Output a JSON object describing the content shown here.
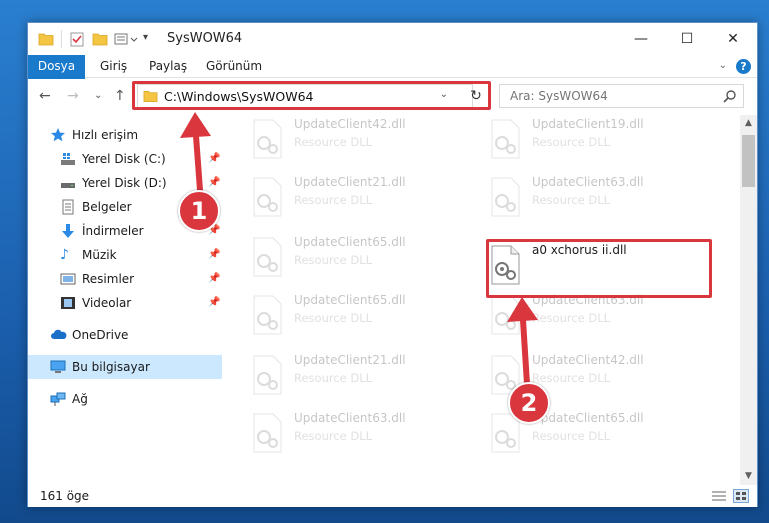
{
  "window": {
    "title": "SysWOW64",
    "controls": {
      "minimize": "—",
      "maximize": "☐",
      "close": "✕"
    }
  },
  "ribbon": {
    "tabs": [
      {
        "label": "Dosya"
      },
      {
        "label": "Giriş"
      },
      {
        "label": "Paylaş"
      },
      {
        "label": "Görünüm"
      }
    ],
    "help": "?"
  },
  "nav": {
    "address": "C:\\Windows\\SysWOW64",
    "search_placeholder": "Ara: SysWOW64"
  },
  "sidebar": {
    "items": [
      {
        "label": "Hızlı erişim"
      },
      {
        "label": "Yerel Disk (C:)"
      },
      {
        "label": "Yerel Disk (D:)"
      },
      {
        "label": "Belgeler"
      },
      {
        "label": "İndirmeler"
      },
      {
        "label": "Müzik"
      },
      {
        "label": "Resimler"
      },
      {
        "label": "Videolar"
      },
      {
        "label": "OneDrive"
      },
      {
        "label": "Bu bilgisayar"
      },
      {
        "label": "Ağ"
      }
    ]
  },
  "files": {
    "left": [
      {
        "name": "UpdateClient42.dll",
        "desc": "Resource DLL"
      },
      {
        "name": "UpdateClient21.dll",
        "desc": "Resource DLL"
      },
      {
        "name": "UpdateClient65.dll",
        "desc": "Resource DLL"
      },
      {
        "name": "UpdateClient65.dll",
        "desc": "Resource DLL"
      },
      {
        "name": "UpdateClient21.dll",
        "desc": "Resource DLL"
      },
      {
        "name": "UpdateClient63.dll",
        "desc": "Resource DLL"
      }
    ],
    "right": [
      {
        "name": "UpdateClient19.dll",
        "desc": "Resource DLL"
      },
      {
        "name": "UpdateClient63.dll",
        "desc": "Resource DLL"
      },
      {
        "name": "a0 xchorus ii.dll",
        "desc": ""
      },
      {
        "name": "UpdateClient63.dll",
        "desc": "Resource DLL"
      },
      {
        "name": "UpdateClient42.dll",
        "desc": "Resource DLL"
      },
      {
        "name": "UpdateClient65.dll",
        "desc": "Resource DLL"
      }
    ]
  },
  "status": {
    "count": "161 öge"
  },
  "annotations": {
    "step1": "1",
    "step2": "2"
  },
  "colors": {
    "accent": "#1979ca",
    "highlight": "#d9363e",
    "selected": "#cce8ff"
  }
}
